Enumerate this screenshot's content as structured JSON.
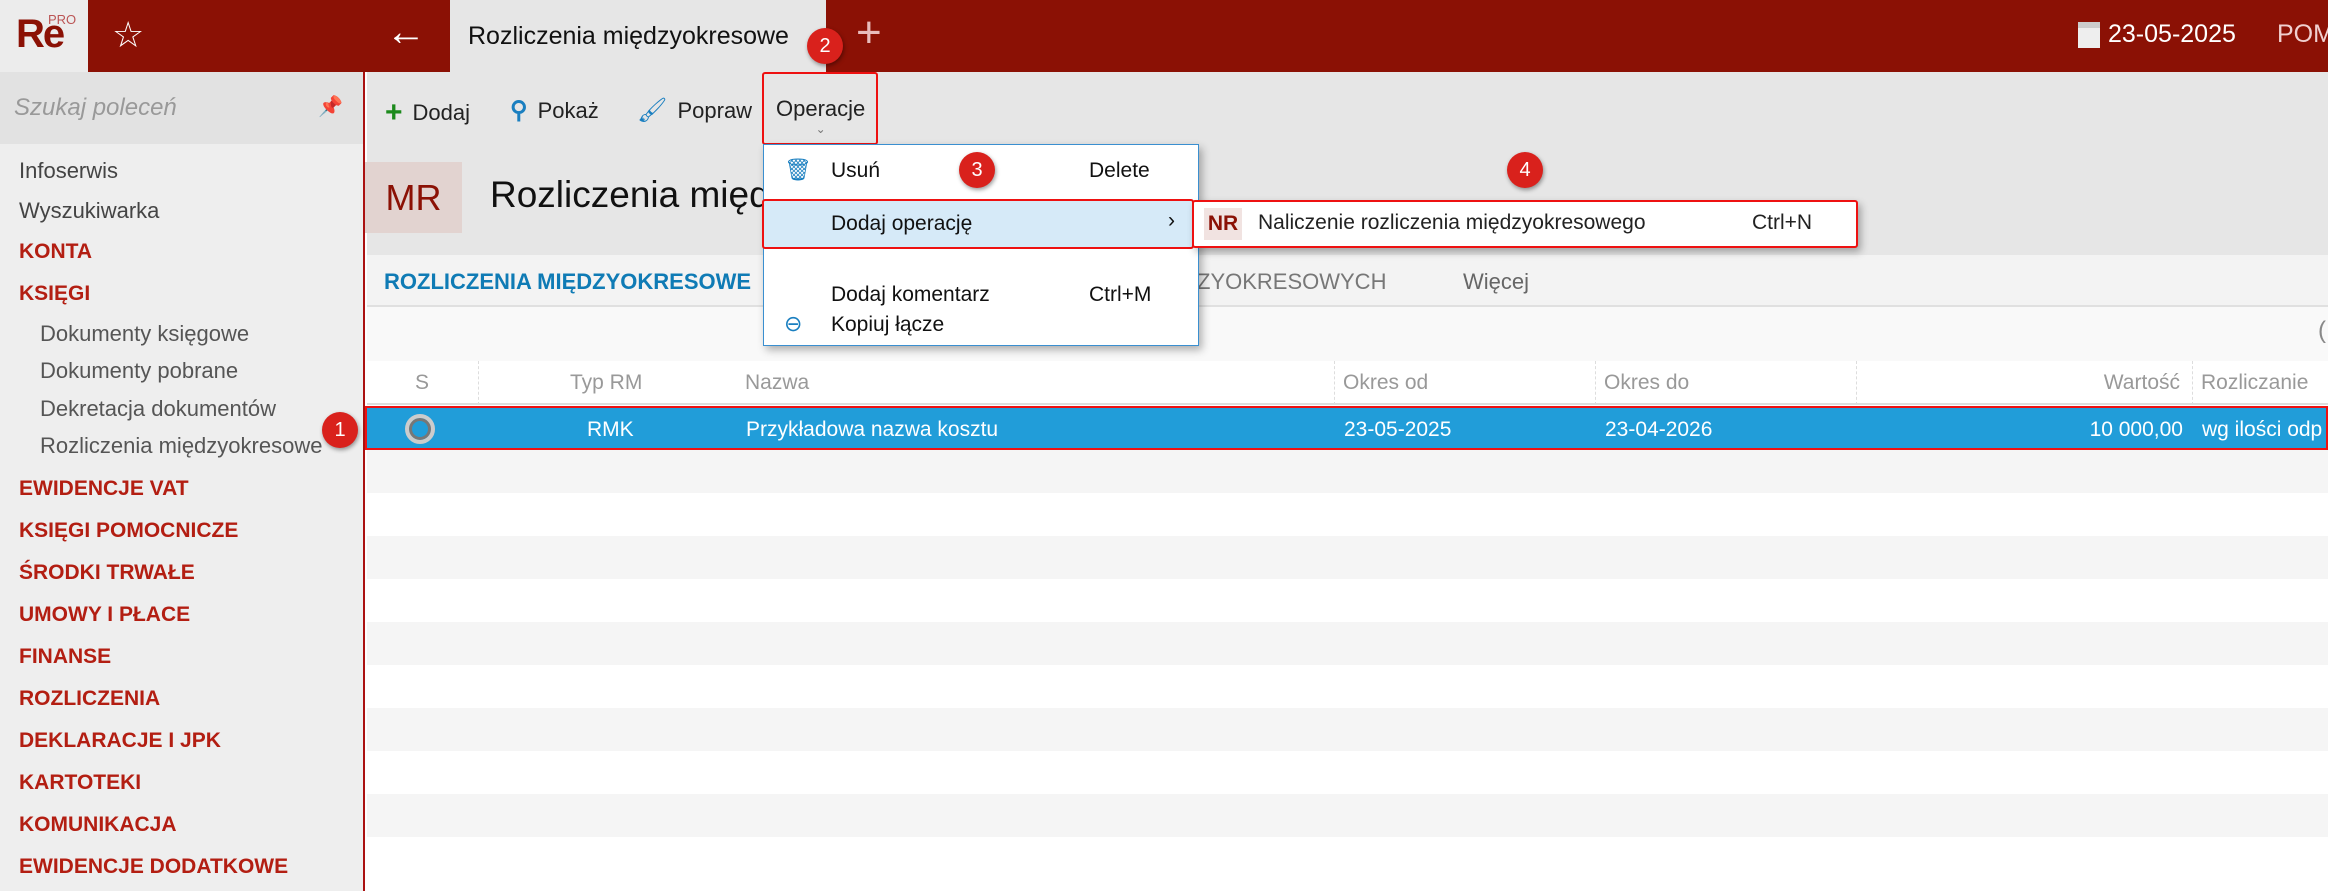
{
  "app": {
    "logo": "Re",
    "logo_sup": "PRO",
    "tab_title": "Rozliczenia międzyokresowe",
    "date": "23-05-2025",
    "user": "POM"
  },
  "sidebar": {
    "search_placeholder": "Szukaj poleceń",
    "items": [
      {
        "label": "Infoserwis",
        "type": "plain"
      },
      {
        "label": "Wyszukiwarka",
        "type": "plain"
      },
      {
        "label": "KONTA",
        "type": "cat"
      },
      {
        "label": "KSIĘGI",
        "type": "cat"
      },
      {
        "label": "Dokumenty księgowe",
        "type": "sub"
      },
      {
        "label": "Dokumenty pobrane",
        "type": "sub"
      },
      {
        "label": "Dekretacja dokumentów",
        "type": "sub"
      },
      {
        "label": "Rozliczenia międzyokresowe",
        "type": "sub"
      },
      {
        "label": "EWIDENCJE VAT",
        "type": "cat"
      },
      {
        "label": "KSIĘGI POMOCNICZE",
        "type": "cat"
      },
      {
        "label": "ŚRODKI TRWAŁE",
        "type": "cat"
      },
      {
        "label": "UMOWY I PŁACE",
        "type": "cat"
      },
      {
        "label": "FINANSE",
        "type": "cat"
      },
      {
        "label": "ROZLICZENIA",
        "type": "cat"
      },
      {
        "label": "DEKLARACJE I JPK",
        "type": "cat"
      },
      {
        "label": "KARTOTEKI",
        "type": "cat"
      },
      {
        "label": "KOMUNIKACJA",
        "type": "cat"
      },
      {
        "label": "EWIDENCJE DODATKOWE",
        "type": "cat"
      }
    ]
  },
  "toolbar": {
    "add": "Dodaj",
    "show": "Pokaż",
    "edit": "Popraw",
    "operations": "Operacje"
  },
  "header": {
    "badge": "MR",
    "title": "Rozliczenia międzyokresowe"
  },
  "tabs": {
    "tab1": "ROZLICZENIA MIĘDZYOKRESOWE",
    "tab2_visible": "ZYOKRESOWYCH",
    "more": "Więcej"
  },
  "filter": {
    "paren": "("
  },
  "grid": {
    "columns": [
      "S",
      "Typ RM",
      "Nazwa",
      "Okres od",
      "Okres do",
      "Wartość",
      "Rozliczanie"
    ],
    "rows": [
      {
        "typ": "RMK",
        "nazwa": "Przykładowa nazwa kosztu",
        "od": "23-05-2025",
        "do": "23-04-2026",
        "wartosc": "10 000,00",
        "rozliczanie": "wg ilości odp"
      }
    ]
  },
  "menu": {
    "items": [
      {
        "label": "Usuń",
        "shortcut": "Delete"
      },
      {
        "label": "Dodaj operację",
        "shortcut": "›"
      },
      {
        "label": "Dodaj komentarz",
        "shortcut": "Ctrl+M"
      },
      {
        "label": "Kopiuj łącze",
        "shortcut": ""
      }
    ]
  },
  "submenu": {
    "badge": "NR",
    "label": "Naliczenie rozliczenia międzyokresowego",
    "shortcut": "Ctrl+N"
  },
  "steps": [
    "1",
    "2",
    "3",
    "4"
  ]
}
